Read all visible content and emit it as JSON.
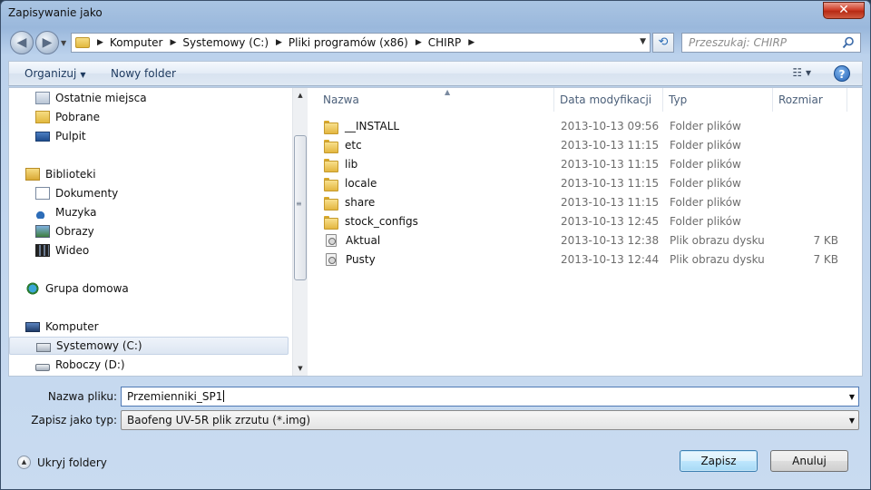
{
  "window": {
    "title": "Zapisywanie jako",
    "close_glyph": "✕"
  },
  "nav": {
    "back_glyph": "◀",
    "forward_glyph": "▶",
    "recent_glyph": "▼",
    "breadcrumbs": [
      "Komputer",
      "Systemowy (C:)",
      "Pliki programów (x86)",
      "CHIRP"
    ],
    "crumb_sep_glyph": "▶",
    "address_dropdown_glyph": "▼",
    "refresh_glyph": "⟲",
    "search_placeholder": "Przeszukaj: CHIRP"
  },
  "toolbar": {
    "organize_label": "Organizuj",
    "organize_caret": "▼",
    "new_folder_label": "Nowy folder",
    "view_glyph": "☷ ▾",
    "help_glyph": "?"
  },
  "sidebar": {
    "items": [
      {
        "label": "Ostatnie miejsca",
        "icon": "recent-places-icon"
      },
      {
        "label": "Pobrane",
        "icon": "downloads-icon"
      },
      {
        "label": "Pulpit",
        "icon": "desktop-icon"
      },
      {
        "label": "Biblioteki",
        "icon": "libraries-icon"
      },
      {
        "label": "Dokumenty",
        "icon": "documents-icon"
      },
      {
        "label": "Muzyka",
        "icon": "music-icon"
      },
      {
        "label": "Obrazy",
        "icon": "pictures-icon"
      },
      {
        "label": "Wideo",
        "icon": "video-icon"
      },
      {
        "label": "Grupa domowa",
        "icon": "homegroup-icon"
      },
      {
        "label": "Komputer",
        "icon": "computer-icon"
      },
      {
        "label": "Systemowy (C:)",
        "icon": "system-drive-icon",
        "selected": true
      },
      {
        "label": "Roboczy (D:)",
        "icon": "drive-icon"
      }
    ],
    "scroll_up_glyph": "▲",
    "scroll_down_glyph": "▼",
    "scroll_grip_glyph": "≡"
  },
  "files": {
    "columns": [
      "Nazwa",
      "Data modyfikacji",
      "Typ",
      "Rozmiar"
    ],
    "sort_glyph": "▲",
    "rows": [
      {
        "name": "__INSTALL",
        "date": "2013-10-13 09:56",
        "type": "Folder plików",
        "size": "",
        "icon": "folder-icon"
      },
      {
        "name": "etc",
        "date": "2013-10-13 11:15",
        "type": "Folder plików",
        "size": "",
        "icon": "folder-icon"
      },
      {
        "name": "lib",
        "date": "2013-10-13 11:15",
        "type": "Folder plików",
        "size": "",
        "icon": "folder-icon"
      },
      {
        "name": "locale",
        "date": "2013-10-13 11:15",
        "type": "Folder plików",
        "size": "",
        "icon": "folder-icon"
      },
      {
        "name": "share",
        "date": "2013-10-13 11:15",
        "type": "Folder plików",
        "size": "",
        "icon": "folder-icon"
      },
      {
        "name": "stock_configs",
        "date": "2013-10-13 12:45",
        "type": "Folder plików",
        "size": "",
        "icon": "folder-icon"
      },
      {
        "name": "Aktual",
        "date": "2013-10-13 12:38",
        "type": "Plik obrazu dysku",
        "size": "7 KB",
        "icon": "disk-image-icon"
      },
      {
        "name": "Pusty",
        "date": "2013-10-13 12:44",
        "type": "Plik obrazu dysku",
        "size": "7 KB",
        "icon": "disk-image-icon"
      }
    ]
  },
  "form": {
    "filename_label": "Nazwa pliku:",
    "filename_value": "Przemienniki_SP1",
    "type_label": "Zapisz jako typ:",
    "type_value": "Baofeng UV-5R plik zrzutu (*.img)",
    "dropdown_glyph": "▼",
    "hide_folders_label": "Ukryj foldery",
    "hide_folders_glyph": "▲",
    "save_label": "Zapisz",
    "cancel_label": "Anuluj"
  },
  "colors": {
    "selection_blue": "#4f79b5",
    "folder_yellow": "#e3b640",
    "title_bar": "#a9c4e2"
  }
}
